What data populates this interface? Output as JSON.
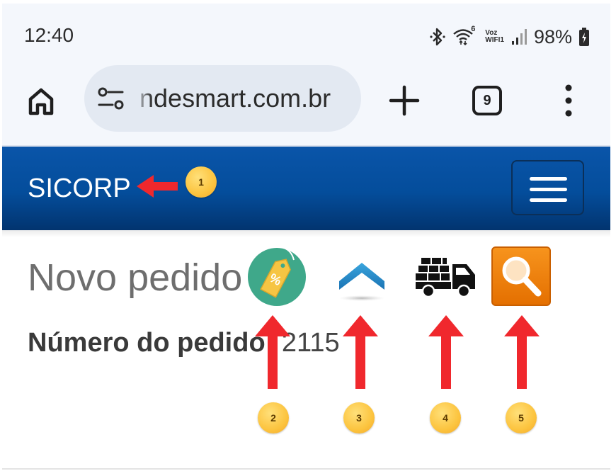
{
  "status_bar": {
    "time": "12:40",
    "wifi_label": "6",
    "voz_label": "Voz",
    "wifi_sub_label": "WIFI1",
    "battery": "98%"
  },
  "browser": {
    "url": "ndesmart.com.br",
    "tab_count": "9",
    "icons": [
      "home-icon",
      "site-settings-icon",
      "plus-icon",
      "tabs-icon",
      "more-vert-icon"
    ]
  },
  "navbar": {
    "brand": "SICORP",
    "toggle_icon": "hamburger-icon",
    "color_top": "#0a55a9",
    "color_bottom": "#02346f"
  },
  "page": {
    "title": "Novo pedido",
    "order_label": "Número do pedido:",
    "order_value": "2115"
  },
  "toolbar_icons": [
    {
      "name": "discount-tag-icon",
      "symbol": "%"
    },
    {
      "name": "scroll-up-icon"
    },
    {
      "name": "delivery-truck-icon"
    },
    {
      "name": "search-icon"
    }
  ],
  "annotations": {
    "badges": [
      "1",
      "2",
      "3",
      "4",
      "5"
    ],
    "arrow_color": "#f0282d",
    "badge_color": "#fcc43f"
  }
}
